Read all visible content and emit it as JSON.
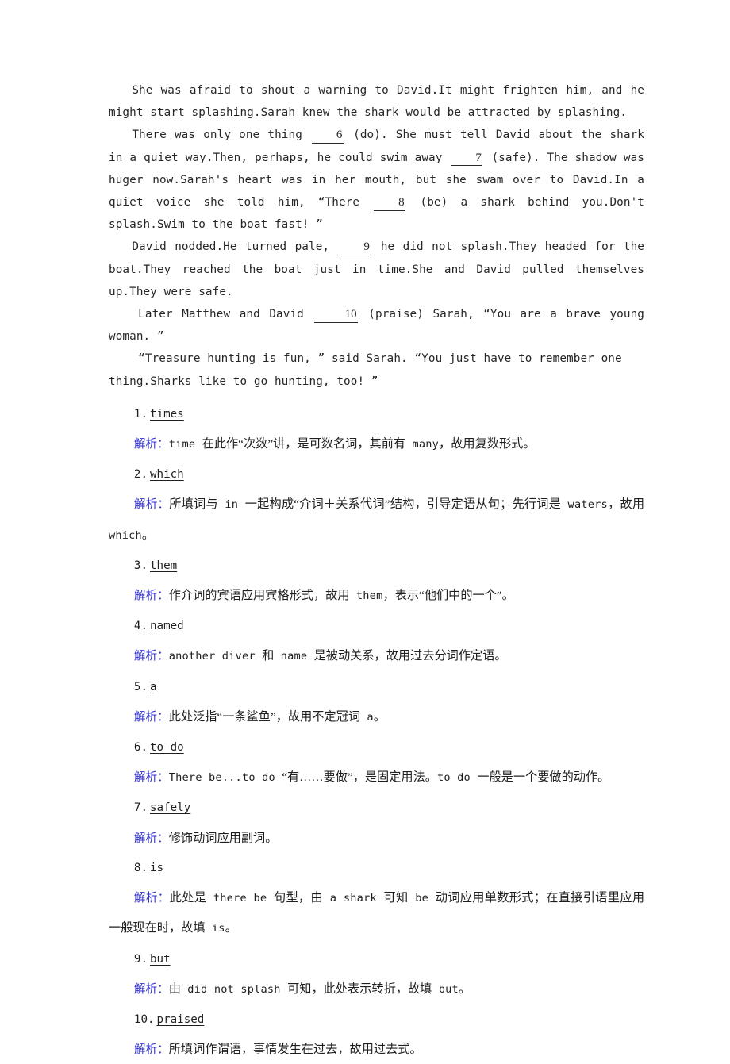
{
  "document": {
    "type": "answer-key",
    "language": "en-zh",
    "accent_color": "#3030cf",
    "text_color": "#1f1f1f"
  },
  "passage": {
    "paragraphs": [
      {
        "id": "p1",
        "segments": [
          {
            "kind": "text",
            "value": "She was afraid to shout a warning to David.It might frighten him, and he might start splashing.Sarah knew the shark would be attracted by splashing."
          }
        ]
      },
      {
        "id": "p2",
        "segments": [
          {
            "kind": "text",
            "value": "There was only one thing "
          },
          {
            "kind": "blank",
            "value": "6"
          },
          {
            "kind": "text",
            "value": " (do). She must tell David about the shark in a quiet way.Then, perhaps, he could swim away "
          },
          {
            "kind": "blank",
            "value": "7"
          },
          {
            "kind": "text",
            "value": " (safe). The shadow was huger now.Sarah's heart was in her mouth, but she swam over to David.In a quiet voice she told him, “There "
          },
          {
            "kind": "blank",
            "value": "8"
          },
          {
            "kind": "text",
            "value": " (be) a shark behind you.Don't splash.Swim to the boat fast! ”"
          }
        ]
      },
      {
        "id": "p3",
        "segments": [
          {
            "kind": "text",
            "value": "David nodded.He turned pale, "
          },
          {
            "kind": "blank",
            "value": "9"
          },
          {
            "kind": "text",
            "value": " he did not splash.They headed for the boat.They reached the boat just in time.She and David pulled themselves up.They were safe."
          }
        ]
      },
      {
        "id": "p4",
        "segments": [
          {
            "kind": "text",
            "value": "Later Matthew and David "
          },
          {
            "kind": "blank",
            "value": "10"
          },
          {
            "kind": "text",
            "value": " (praise) Sarah, “You are a brave young woman. ”"
          }
        ]
      },
      {
        "id": "p5",
        "segments": [
          {
            "kind": "text",
            "value": "“Treasure hunting is fun, ” said Sarah. “You just have to remember one thing.Sharks like to go hunting, too! ”"
          }
        ]
      }
    ]
  },
  "answers": {
    "explanation_label": "解析",
    "explanation_colon": "：",
    "items": [
      {
        "number": "1.",
        "word": "times",
        "explanation": "time 在此作“次数”讲，是可数名词，其前有 many，故用复数形式。"
      },
      {
        "number": "2.",
        "word": "which",
        "explanation": "所填词与 in 一起构成“介词＋关系代词”结构，引导定语从句；先行词是 waters，故用 which。"
      },
      {
        "number": "3.",
        "word": "them",
        "explanation": "作介词的宾语应用宾格形式，故用 them，表示“他们中的一个”。"
      },
      {
        "number": "4.",
        "word": "named",
        "explanation": "another diver 和 name 是被动关系，故用过去分词作定语。"
      },
      {
        "number": "5.",
        "word": "a",
        "explanation": "此处泛指“一条鲨鱼”，故用不定冠词 a。"
      },
      {
        "number": "6.",
        "word": "to do",
        "explanation": "There be...to do “有……要做”，是固定用法。to do 一般是一个要做的动作。"
      },
      {
        "number": "7.",
        "word": "safely",
        "explanation": "修饰动词应用副词。"
      },
      {
        "number": "8.",
        "word": "is",
        "explanation": "此处是 there be 句型，由 a shark 可知 be 动词应用单数形式；在直接引语里应用一般现在时，故填 is。"
      },
      {
        "number": "9.",
        "word": "but",
        "explanation": "由 did not splash 可知，此处表示转折，故填 but。"
      },
      {
        "number": "10.",
        "word": "praised",
        "explanation": "所填词作谓语，事情发生在过去，故用过去式。"
      }
    ]
  }
}
